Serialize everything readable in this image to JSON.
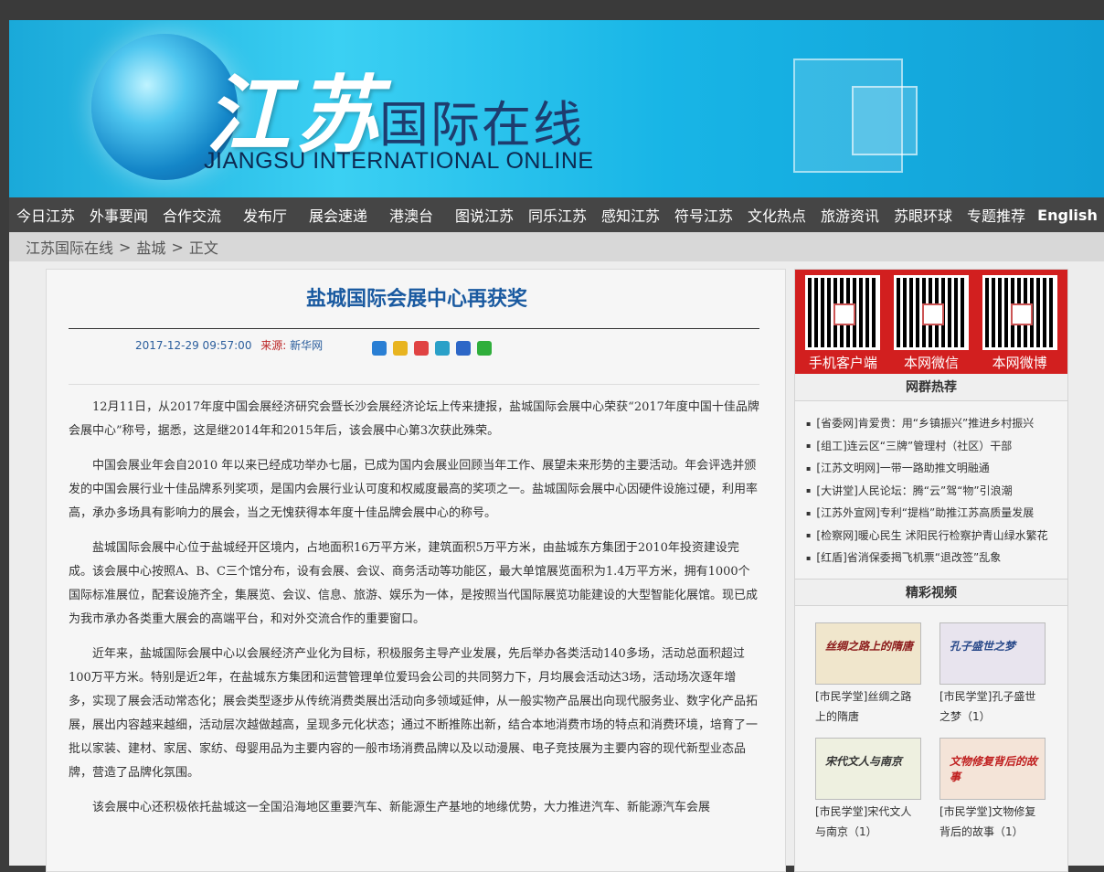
{
  "site": {
    "logo_script": "江苏",
    "logo_title": "国际在线",
    "logo_en": "JIANGSU INTERNATIONAL ONLINE"
  },
  "nav": [
    "今日江苏",
    "外事要闻",
    "合作交流",
    "发布厅",
    "展会速递",
    "港澳台",
    "图说江苏",
    "同乐江苏",
    "感知江苏",
    "符号江苏",
    "文化热点",
    "旅游资讯",
    "苏眼环球",
    "专题推荐",
    "English"
  ],
  "breadcrumb": [
    "江苏国际在线",
    ">",
    "盐城",
    ">",
    "正文"
  ],
  "article": {
    "title": "盐城国际会展中心再获奖",
    "datetime": "2017-12-29 09:57:00",
    "source_label": "来源:",
    "source_name": "新华网",
    "paragraphs": [
      "12月11日，从2017年度中国会展经济研究会暨长沙会展经济论坛上传来捷报，盐城国际会展中心荣获“2017年度中国十佳品牌会展中心”称号，据悉，这是继2014年和2015年后，该会展中心第3次获此殊荣。",
      "中国会展业年会自2010 年以来已经成功举办七届，已成为国内会展业回顾当年工作、展望未来形势的主要活动。年会评选并颁发的中国会展行业十佳品牌系列奖项，是国内会展行业认可度和权威度最高的奖项之一。盐城国际会展中心因硬件设施过硬，利用率高，承办多场具有影响力的展会，当之无愧获得本年度十佳品牌会展中心的称号。",
      "盐城国际会展中心位于盐城经开区境内，占地面积16万平方米，建筑面积5万平方米，由盐城东方集团于2010年投资建设完成。该会展中心按照A、B、C三个馆分布，设有会展、会议、商务活动等功能区，最大单馆展览面积为1.4万平方米，拥有1000个国际标准展位，配套设施齐全，集展览、会议、信息、旅游、娱乐为一体，是按照当代国际展览功能建设的大型智能化展馆。现已成为我市承办各类重大展会的高端平台，和对外交流合作的重要窗口。",
      "近年来，盐城国际会展中心以会展经济产业化为目标，积极服务主导产业发展，先后举办各类活动140多场，活动总面积超过100万平方米。特别是近2年，在盐城东方集团和运营管理单位爱玛会公司的共同努力下，月均展会活动达3场，活动场次逐年增多，实现了展会活动常态化；展会类型逐步从传统消费类展出活动向多领域延伸，从一般实物产品展出向现代服务业、数字化产品拓展，展出内容越来越细，活动层次越做越高，呈现多元化状态；通过不断推陈出新，结合本地消费市场的特点和消费环境，培育了一批以家装、建材、家居、家纺、母婴用品为主要内容的一般市场消费品牌以及以动漫展、电子竞技展为主要内容的现代新型业态品牌，营造了品牌化氛围。",
      "该会展中心还积极依托盐城这一全国沿海地区重要汽车、新能源生产基地的地缘优势，大力推进汽车、新能源汽车会展"
    ]
  },
  "sidebar": {
    "qr": [
      "手机客户端",
      "本网微信",
      "本网微博"
    ],
    "hot_title": "网群热荐",
    "hot": [
      "[省委网]肯爱贵：用“乡镇振兴”推进乡村振兴",
      "[组工]连云区“三牌”管理村（社区）干部",
      "[江苏文明网]一带一路助推文明融通",
      "[大讲堂]人民论坛：腾“云”驾“物”引浪潮",
      "[江苏外宣网]专利“提档”助推江苏高质量发展",
      "[检察网]暖心民生 沭阳民行检察护青山绿水繁花",
      "[红盾]省消保委揭飞机票“退改签”乱象"
    ],
    "video_title": "精彩视频",
    "videos": [
      {
        "thumb": "丝绸之路上的隋唐",
        "caption": "[市民学堂]丝绸之路上的隋唐"
      },
      {
        "thumb": "孔子盛世之梦",
        "caption": "[市民学堂]孔子盛世之梦（1）"
      },
      {
        "thumb": "宋代文人与南京",
        "caption": "[市民学堂]宋代文人与南京（1）"
      },
      {
        "thumb": "文物修复背后的故事",
        "caption": "[市民学堂]文物修复背后的故事（1）"
      }
    ]
  }
}
